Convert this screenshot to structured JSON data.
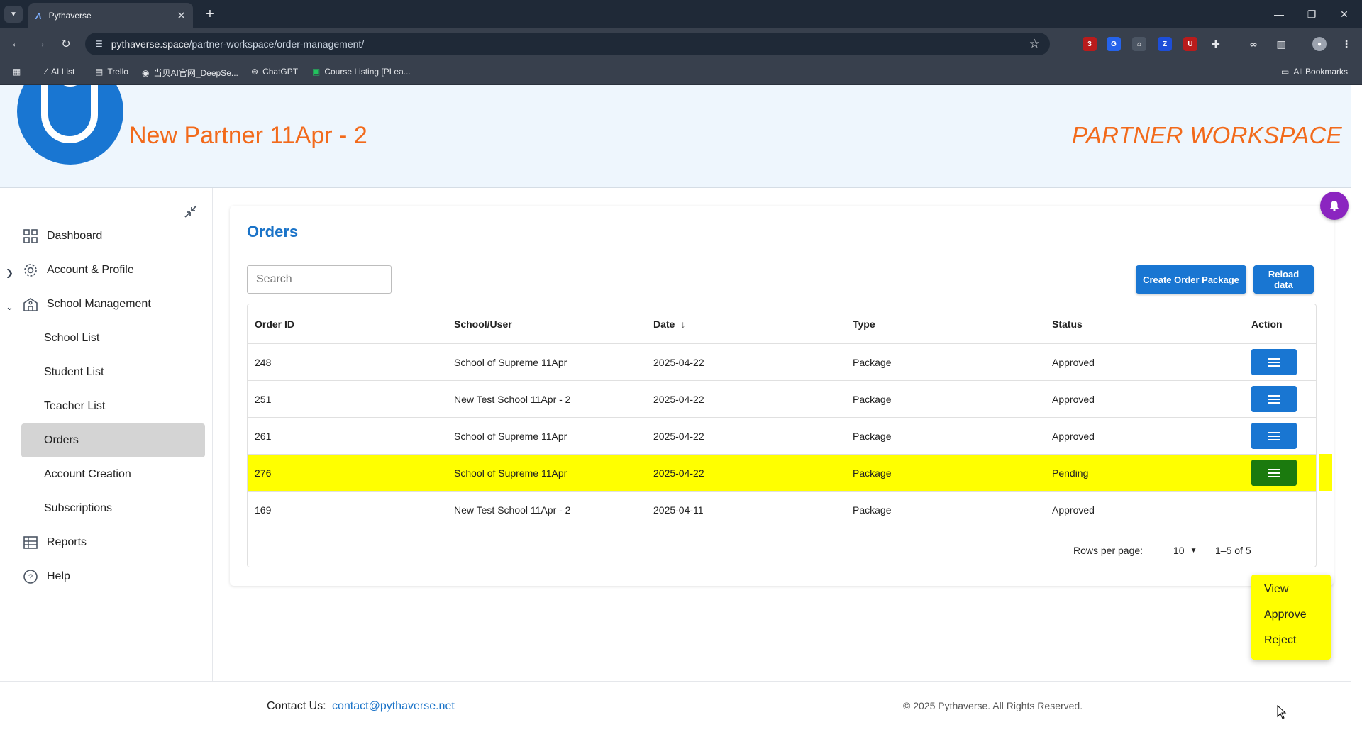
{
  "browser": {
    "tab_title": "Pythaverse",
    "url_host": "pythaverse.space",
    "url_path": "/partner-workspace/order-management/",
    "bookmarks": [
      "AI List",
      "Trello",
      "当贝AI官网_DeepSe...",
      "ChatGPT",
      "Course Listing [PLea..."
    ],
    "all_bookmarks": "All Bookmarks",
    "ext_badge": "3"
  },
  "header": {
    "partner_name": "New Partner 11Apr - 2",
    "workspace_label": "PARTNER WORKSPACE"
  },
  "sidebar": {
    "dashboard": "Dashboard",
    "account_profile": "Account & Profile",
    "school_management": "School Management",
    "sub_items": [
      "School List",
      "Student List",
      "Teacher List",
      "Orders",
      "Account Creation",
      "Subscriptions"
    ],
    "reports": "Reports",
    "help": "Help"
  },
  "orders": {
    "title": "Orders",
    "search_placeholder": "Search",
    "create_button": "Create Order Package",
    "reload_button": "Reload data",
    "columns": [
      "Order ID",
      "School/User",
      "Date",
      "Type",
      "Status",
      "Action"
    ],
    "rows": [
      {
        "id": "248",
        "school": "School of Supreme 11Apr",
        "date": "2025-04-22",
        "type": "Package",
        "status": "Approved"
      },
      {
        "id": "251",
        "school": "New Test School 11Apr - 2",
        "date": "2025-04-22",
        "type": "Package",
        "status": "Approved"
      },
      {
        "id": "261",
        "school": "School of Supreme 11Apr",
        "date": "2025-04-22",
        "type": "Package",
        "status": "Approved"
      },
      {
        "id": "276",
        "school": "School of Supreme 11Apr",
        "date": "2025-04-22",
        "type": "Package",
        "status": "Pending"
      },
      {
        "id": "169",
        "school": "New Test School 11Apr - 2",
        "date": "2025-04-11",
        "type": "Package",
        "status": "Approved"
      }
    ],
    "rows_per_page_label": "Rows per page:",
    "rows_per_page_value": "10",
    "range": "1–5 of 5",
    "action_menu": [
      "View",
      "Approve",
      "Reject"
    ]
  },
  "footer": {
    "contact_label": "Contact Us:",
    "contact_email": "contact@pythaverse.net",
    "copyright": "© 2025 Pythaverse. All Rights Reserved."
  },
  "colors": {
    "accent_blue": "#1976d2",
    "brand_orange": "#f26a1b",
    "highlight_yellow": "#ffff00",
    "action_green": "#1b7a0e",
    "bell_purple": "#8b25c0"
  }
}
